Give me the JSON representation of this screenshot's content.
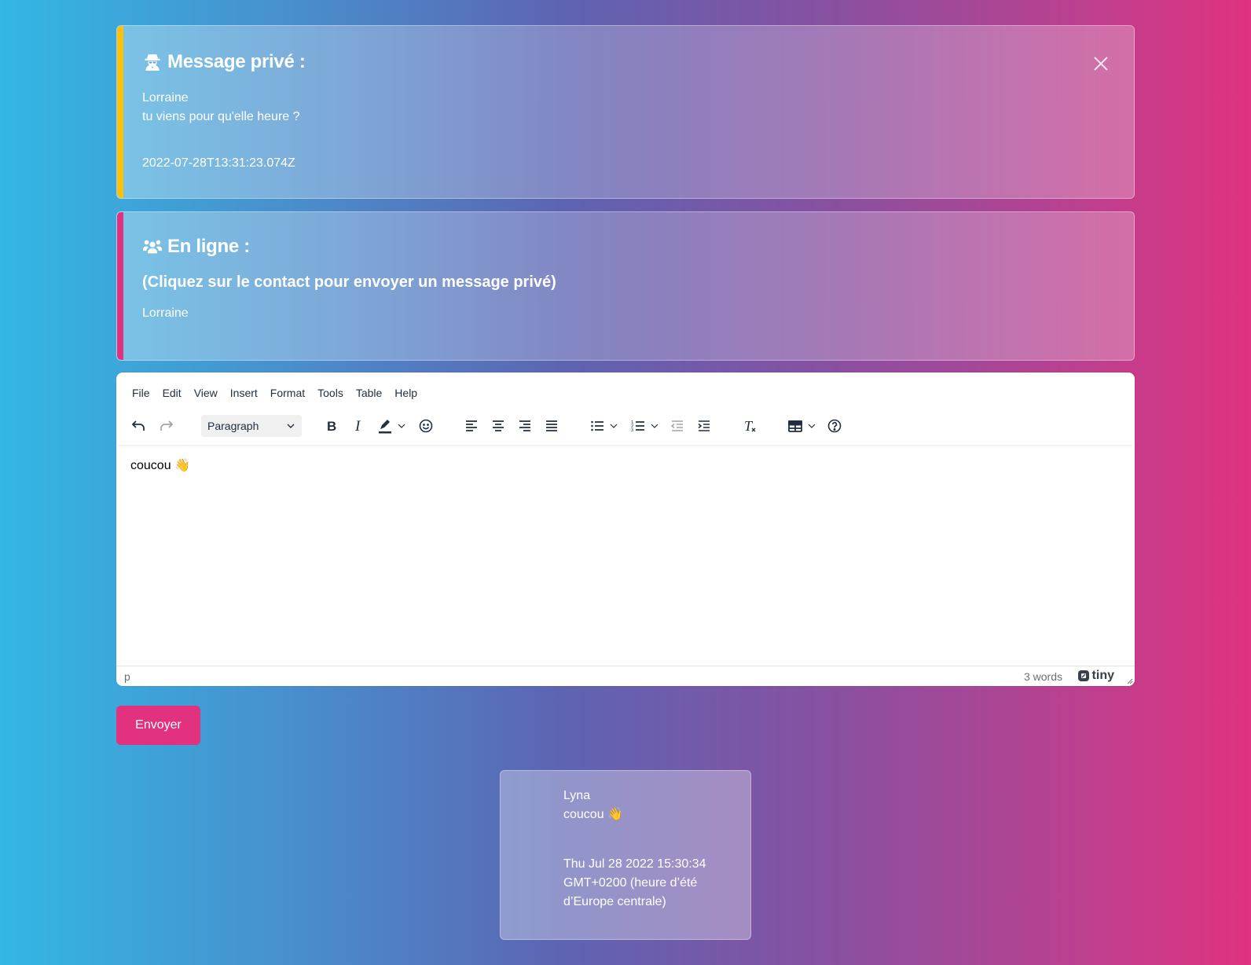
{
  "private_message": {
    "title": "Message privé :",
    "sender": "Lorraine",
    "text": "tu viens pour qu'elle heure ?",
    "timestamp": "2022-07-28T13:31:23.074Z",
    "accent_color": "#ffc107",
    "icon": "user-secret-icon"
  },
  "online": {
    "title": "En ligne :",
    "subtitle": "(Cliquez sur le contact pour envoyer un message privé)",
    "contacts": [
      "Lorraine"
    ],
    "accent_color": "#e2317f",
    "icon": "users-icon"
  },
  "editor": {
    "menu": [
      "File",
      "Edit",
      "View",
      "Insert",
      "Format",
      "Tools",
      "Table",
      "Help"
    ],
    "block_format": "Paragraph",
    "content": "coucou 👋",
    "status_path": "p",
    "word_count": "3 words",
    "brand": "tiny"
  },
  "send_button": {
    "label": "Envoyer",
    "color": "#e2317f"
  },
  "messages": [
    {
      "author": "Lyna",
      "text": "coucou 👋",
      "date": "Thu Jul 28 2022 15:30:34 GMT+0200 (heure d’été d’Europe centrale)"
    }
  ]
}
